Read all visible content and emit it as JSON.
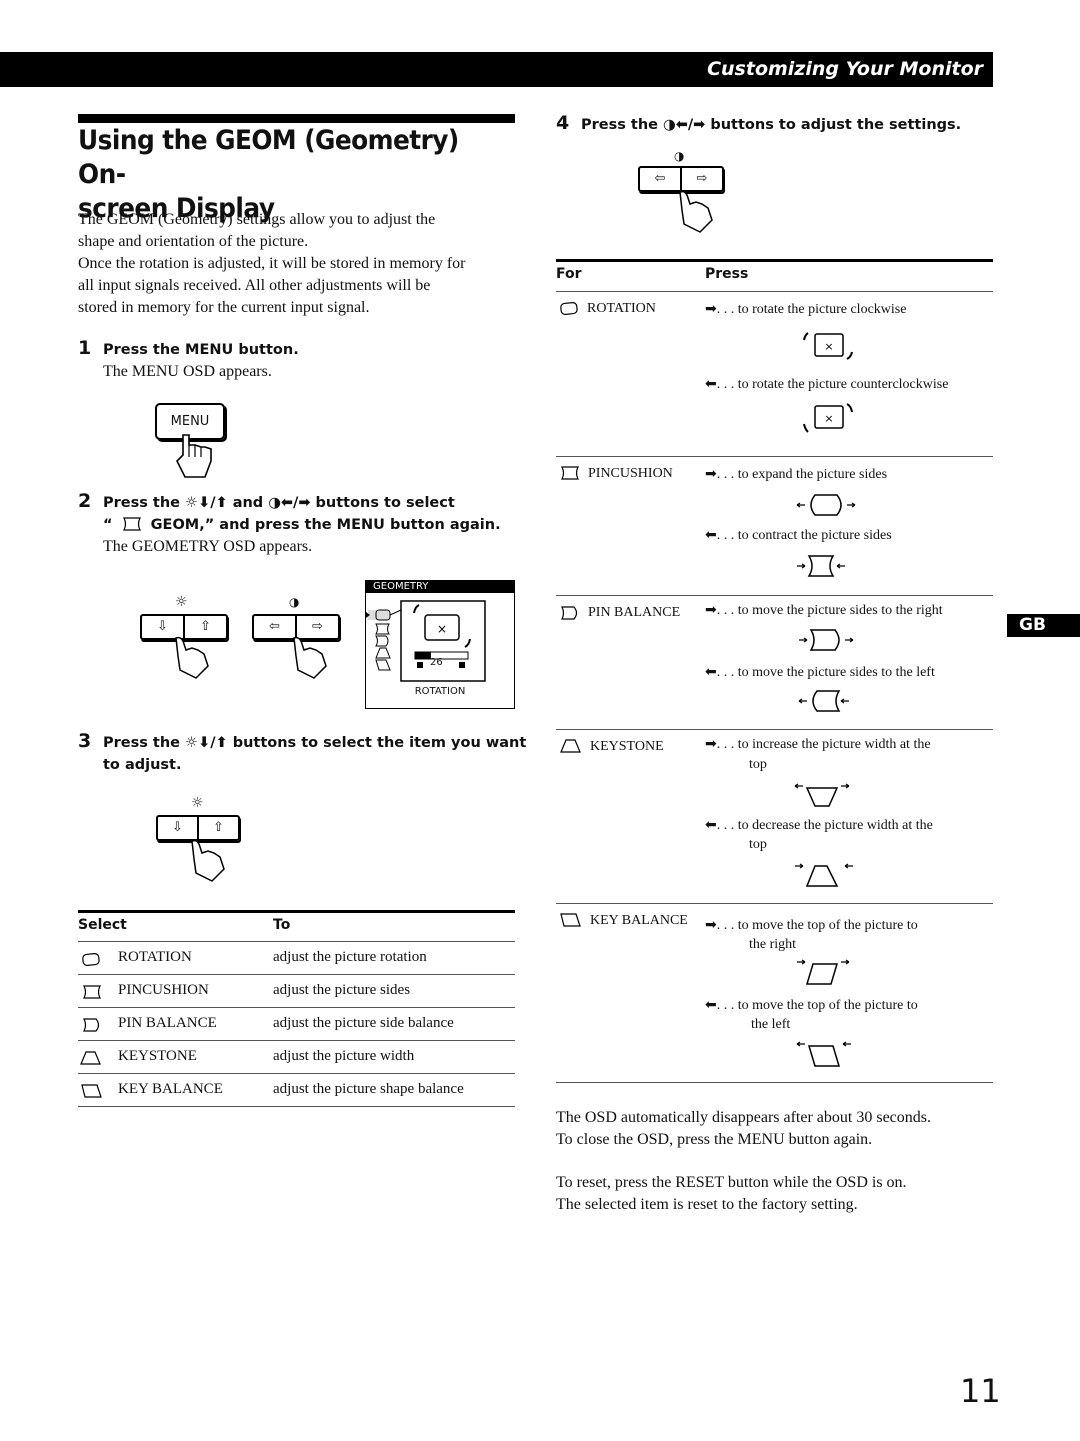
{
  "header": {
    "section_title": "Customizing Your Monitor"
  },
  "title": "Using the GEOM (Geometry) On-screen Display",
  "title_lines": [
    "Using the GEOM (Geometry) On-",
    "screen Display"
  ],
  "intro": [
    "The GEOM (Geometry) settings allow you to adjust the",
    "shape and orientation of the picture.",
    "Once the rotation is adjusted, it will be stored in memory for",
    "all input signals received. All other adjustments will be",
    "stored in memory for the current input signal."
  ],
  "steps": [
    {
      "num": "1",
      "title": "Press the MENU button.",
      "note": "The MENU OSD appears."
    },
    {
      "num": "2",
      "title_line1": "Press the ☼⬇/⬆ and ◑⬅/➡ buttons to select",
      "title_line2_prefix": "“",
      "title_line2": "GEOM,” and press the MENU button again.",
      "note": "The GEOMETRY OSD appears."
    },
    {
      "num": "3",
      "title_line1": "Press the  ☼⬇/⬆ buttons to select the item you want",
      "title_line2": "to adjust."
    },
    {
      "num": "4",
      "title": "Press the ◑⬅/➡ buttons to adjust the settings."
    }
  ],
  "menu_button": {
    "label": "MENU"
  },
  "icons": {
    "brightness": "☼",
    "contrast": "◑",
    "down": "⇩",
    "up": "⇧",
    "left": "⇦",
    "right": "⇨",
    "arrow_right": "➡",
    "arrow_left": "⬅"
  },
  "osd": {
    "title": "GEOMETRY",
    "value": "26",
    "value_fraction": 0.3,
    "selected_label": "ROTATION"
  },
  "select_table": {
    "headers": [
      "Select",
      "To"
    ],
    "rows": [
      {
        "icon": "rotation-icon",
        "item": "ROTATION",
        "to": "adjust the picture rotation"
      },
      {
        "icon": "pincushion-icon",
        "item": "PINCUSHION",
        "to": "adjust the picture sides"
      },
      {
        "icon": "pin-balance-icon",
        "item": "PIN BALANCE",
        "to": "adjust the picture side balance"
      },
      {
        "icon": "keystone-icon",
        "item": "KEYSTONE",
        "to": "adjust the picture width"
      },
      {
        "icon": "key-balance-icon",
        "item": "KEY BALANCE",
        "to": "adjust the picture shape balance"
      }
    ]
  },
  "press_table": {
    "headers": [
      "For",
      "Press"
    ],
    "rows": [
      {
        "item": "ROTATION",
        "right": ". . . to rotate the picture clockwise",
        "left": ". . . to rotate the picture counterclockwise"
      },
      {
        "item": "PINCUSHION",
        "right": ". . . to expand the picture sides",
        "left": ". . . to contract the picture sides"
      },
      {
        "item": "PIN BALANCE",
        "right": ". . . to move the picture sides to the right",
        "left": ". . . to move the picture sides to the left"
      },
      {
        "item": "KEYSTONE",
        "right": ". . . to increase the picture width at the",
        "right2": "top",
        "left": ". . . to decrease the picture width at the",
        "left2": "top"
      },
      {
        "item": "KEY BALANCE",
        "right": ". . . to move the top of  the picture to",
        "right2": "the right",
        "left": ". . .  to move the top of  the picture to",
        "left2": "the left"
      }
    ]
  },
  "footer_notes": [
    "The OSD automatically disappears after about 30 seconds.",
    "To close the OSD, press the MENU button again.",
    "To reset,  press the RESET button while the OSD is on.",
    "The selected item is reset to the factory setting."
  ],
  "language_tab": "GB",
  "page_number": "11"
}
